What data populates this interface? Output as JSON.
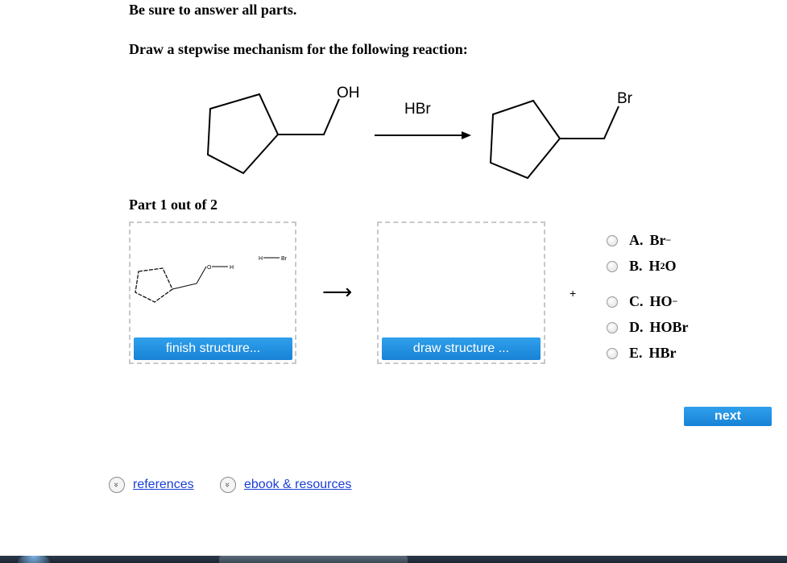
{
  "instructions": {
    "line1": "Be sure to answer all parts.",
    "line2": "Draw a stepwise mechanism for the following reaction:"
  },
  "reaction": {
    "reactant_group": "OH",
    "reagent": "HBr",
    "product_group": "Br"
  },
  "part": {
    "label": "Part 1 out of 2"
  },
  "workspace": {
    "box1_labels": {
      "oh_o": "O",
      "oh_h": "H",
      "hbr_h": "H",
      "hbr_br": "Br"
    },
    "finish_button": "finish structure...",
    "draw_button": "draw structure ...",
    "arrow": "⟶",
    "plus": "+"
  },
  "options": [
    {
      "letter": "A.",
      "main": "Br",
      "sup": "−",
      "sub": "",
      "rest": ""
    },
    {
      "letter": "B.",
      "main": "H",
      "sup": "",
      "sub": "2",
      "rest": "O"
    },
    {
      "letter": "C.",
      "main": "HO",
      "sup": "−",
      "sub": "",
      "rest": ""
    },
    {
      "letter": "D.",
      "main": "HOBr",
      "sup": "",
      "sub": "",
      "rest": ""
    },
    {
      "letter": "E.",
      "main": "HBr",
      "sup": "",
      "sub": "",
      "rest": ""
    }
  ],
  "next_button": "next",
  "links": {
    "references": "references",
    "ebook": "ebook & resources"
  },
  "icons": {
    "expand": "double-chevron-down-icon"
  }
}
